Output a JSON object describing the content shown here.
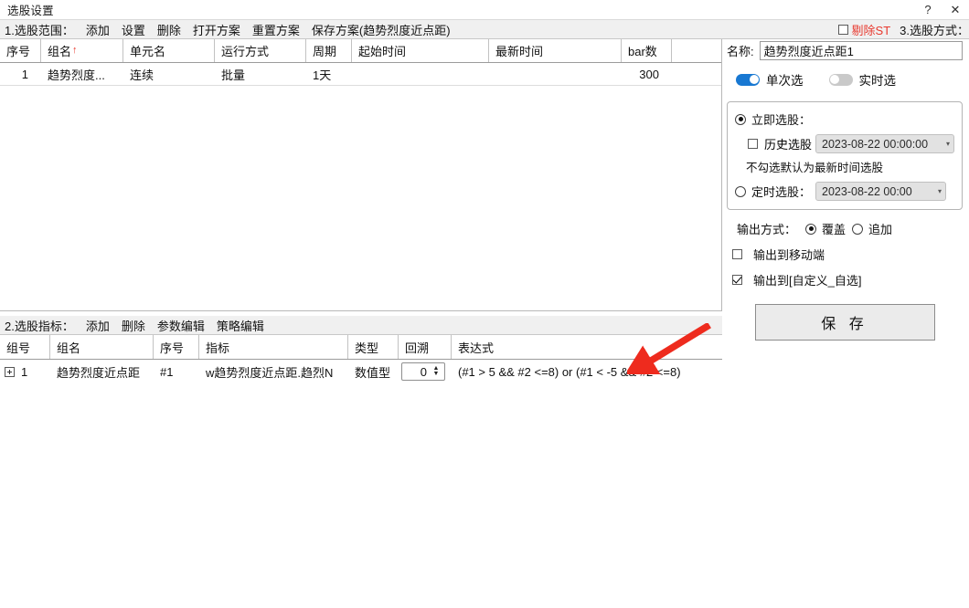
{
  "window": {
    "title": "选股设置",
    "help_label": "?",
    "close_label": "✕"
  },
  "section1": {
    "label": "1.选股范围：",
    "actions": [
      "添加",
      "设置",
      "删除",
      "打开方案",
      "重置方案",
      "保存方案(趋势烈度近点距)"
    ],
    "exclude_st": {
      "label": "剔除ST",
      "checked": false
    },
    "table": {
      "columns": [
        "序号",
        "组名",
        "单元名",
        "运行方式",
        "周期",
        "起始时间",
        "最新时间",
        "bar数"
      ],
      "sorted_column": "组名",
      "sort_arrow": "↑",
      "rows": [
        {
          "序号": "1",
          "组名": "趋势烈度...",
          "单元名": "连续",
          "运行方式": "批量",
          "周期": "1天",
          "起始时间": "",
          "最新时间": "",
          "bar数": "300"
        }
      ]
    }
  },
  "section2": {
    "label": "2.选股指标：",
    "actions": [
      "添加",
      "删除",
      "参数编辑",
      "策略编辑"
    ],
    "table": {
      "columns": [
        "组号",
        "组名",
        "序号",
        "指标",
        "类型",
        "回溯",
        "表达式"
      ],
      "rows": [
        {
          "组号": "1",
          "组名": "趋势烈度近点距",
          "序号": "#1",
          "指标": "w趋势烈度近点距.趋烈N",
          "类型": "数值型",
          "回溯": "0",
          "表达式": "(#1 > 5 && #2 <=8) or (#1 < -5 && #2 <=8)"
        }
      ]
    }
  },
  "section3": {
    "label": "3.选股方式：",
    "name_field": {
      "label": "名称:",
      "value": "趋势烈度近点距1",
      "placeholder": ""
    },
    "toggles": [
      {
        "label": "单次选",
        "on": true
      },
      {
        "label": "实时选",
        "on": false
      }
    ],
    "mode_group": {
      "immediate": {
        "label": "立即选股：",
        "selected": true
      },
      "history": {
        "label": "历史选股",
        "checked": false,
        "datetime": "2023-08-22 00:00:00",
        "arrow": "▾"
      },
      "hint": "不勾选默认为最新时间选股",
      "scheduled": {
        "label": "定时选股：",
        "selected": false,
        "datetime": "2023-08-22 00:00",
        "arrow": "▾"
      }
    },
    "output_mode": {
      "label": "输出方式：",
      "options": [
        {
          "label": "覆盖",
          "selected": true
        },
        {
          "label": "追加",
          "selected": false
        }
      ]
    },
    "output_targets": [
      {
        "label": "输出到移动端",
        "checked": false
      },
      {
        "label": "输出到[自定义_自选]",
        "checked": true
      }
    ],
    "save_button": "保 存"
  },
  "annotation": {
    "arrow_color": "#ee2b1e"
  }
}
